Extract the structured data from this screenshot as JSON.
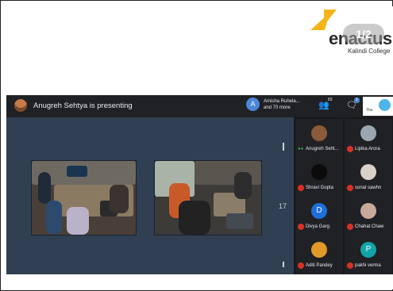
{
  "logo": {
    "word": "enactus",
    "sub": "Kalindi College"
  },
  "page_indicator": "1/2",
  "meet_bar": {
    "presenter_text": "Anugreh Sehtya is presenting",
    "people_initial": "A",
    "people_line1": "Amisha Ruhela...",
    "people_line2": "and 70 more",
    "participants_count": "83",
    "chat_badge": "1",
    "you_label": "You"
  },
  "screen": {
    "number": "17"
  },
  "participants": [
    {
      "name": "Anugreh Seht...",
      "initial": "",
      "color": "#8a5a3a",
      "mic_on": true
    },
    {
      "name": "Lipika Arora",
      "initial": "",
      "color": "#9aa6b0",
      "mic_on": false
    },
    {
      "name": "Shravi Gupta",
      "initial": "",
      "color": "#0b0b0b",
      "mic_on": false
    },
    {
      "name": "sonal sawhn",
      "initial": "",
      "color": "#d9d0c8",
      "mic_on": false
    },
    {
      "name": "Divya Garg",
      "initial": "D",
      "color": "#1e6fd9",
      "mic_on": false
    },
    {
      "name": "Chahat Chaw",
      "initial": "",
      "color": "#c8a89a",
      "mic_on": false
    },
    {
      "name": "Aditi Pandey",
      "initial": "",
      "color": "#e09a2a",
      "mic_on": false
    },
    {
      "name": "pakhi verma",
      "initial": "P",
      "color": "#12a4a8",
      "mic_on": false
    }
  ]
}
